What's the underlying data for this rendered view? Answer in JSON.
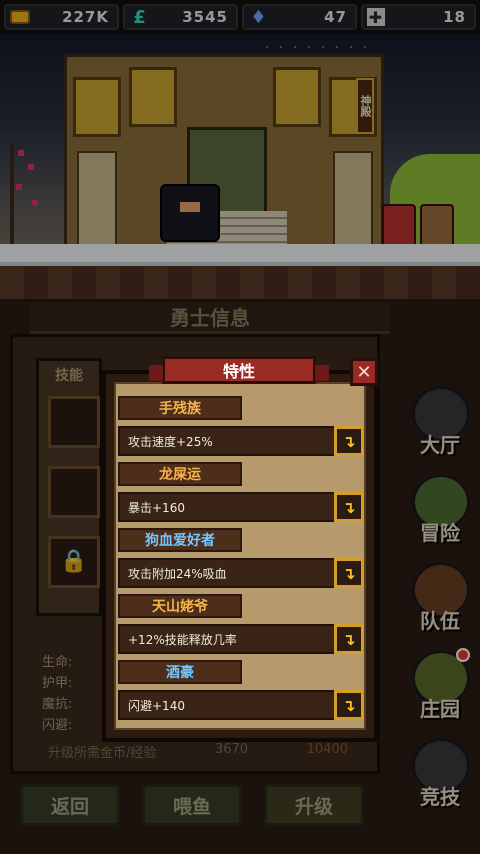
{
  "topbar": {
    "gold": "227K",
    "energy": "3545",
    "gems": "47",
    "tokens": "18"
  },
  "scene": {
    "temple_sign": "神殿"
  },
  "hero_panel": {
    "title": "勇士信息",
    "skills_label": "技能",
    "stats": {
      "hp_label": "生命:",
      "armor_label": "护甲:",
      "magic_resist_label": "魔抗:",
      "dodge_label": "闪避:"
    },
    "upgrade_label": "升级所需金币/经验",
    "upgrade_cost": "3670",
    "upgrade_cost_2": "10400"
  },
  "modal": {
    "title": "特性",
    "close_icon": "close-icon",
    "traits": [
      {
        "name": "手残族",
        "desc": "攻击速度+25%",
        "name_color": "#f7b44a"
      },
      {
        "name": "龙屎运",
        "desc": "暴击+160",
        "name_color": "#f7b44a"
      },
      {
        "name": "狗血爱好者",
        "desc": "攻击附加24%吸血",
        "name_color": "#74c8ff"
      },
      {
        "name": "天山姥爷",
        "desc": "+12%技能释放几率",
        "name_color": "#f7b44a"
      },
      {
        "name": "酒豪",
        "desc": "闪避+140",
        "name_color": "#74c8ff"
      }
    ]
  },
  "nav": {
    "hall": "大厅",
    "adventure": "冒险",
    "team": "队伍",
    "manor": "庄园",
    "arena": "竞技"
  },
  "bottom": {
    "back": "返回",
    "feed": "喂鱼",
    "upgrade": "升级"
  },
  "colors": {
    "accent_gold": "#d2a02a",
    "modal_red": "#9a2a24"
  }
}
